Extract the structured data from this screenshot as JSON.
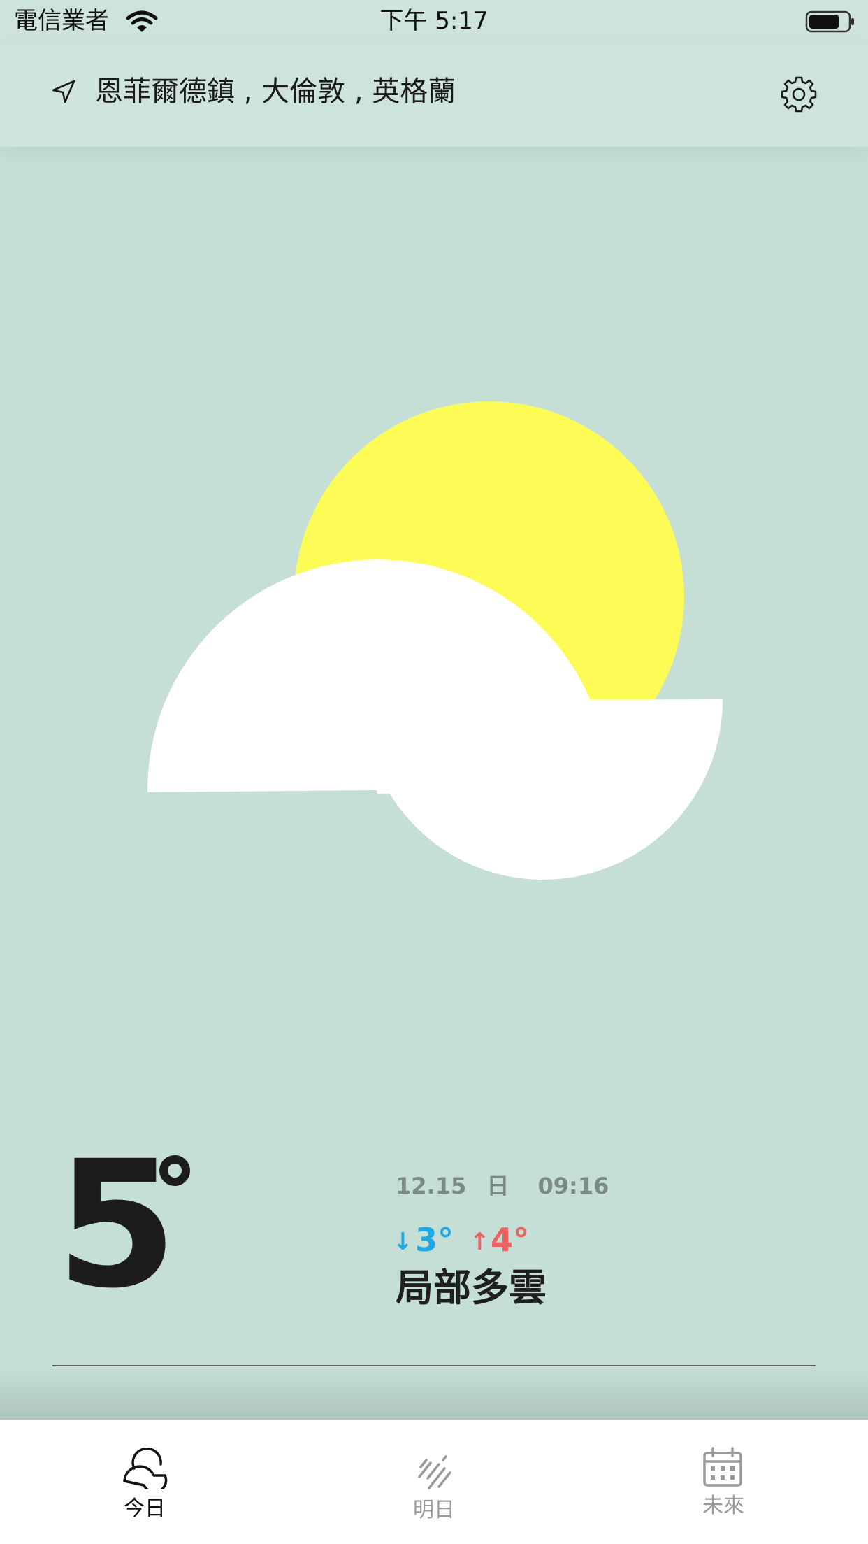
{
  "status_bar": {
    "carrier": "電信業者",
    "time": "下午 5:17"
  },
  "header": {
    "location": "恩菲爾德鎮 , 大倫敦 , 英格蘭"
  },
  "current": {
    "temperature": "5",
    "date": "12.15",
    "weekday": "日",
    "time": "09:16",
    "low_arrow": "↓",
    "low": "3°",
    "high_arrow": "↑",
    "high": "4°",
    "condition": "局部多雲"
  },
  "tabs": [
    {
      "label": "今日",
      "icon": "cloud-sun-icon",
      "active": true
    },
    {
      "label": "明日",
      "icon": "rain-icon",
      "active": false
    },
    {
      "label": "未來",
      "icon": "calendar-icon",
      "active": false
    }
  ],
  "colors": {
    "background": "#c5dfd6",
    "header": "#cde3db",
    "sun": "#fdfc56",
    "cloud": "#ffffff",
    "low": "#1fa8e8",
    "high": "#ef6262",
    "tab_active": "#111111",
    "tab_inactive": "#9a9a9a"
  }
}
